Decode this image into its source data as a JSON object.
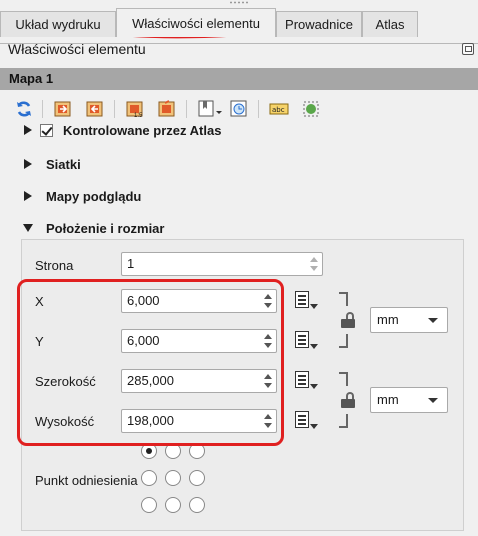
{
  "tabs": [
    {
      "label": "Układ wydruku"
    },
    {
      "label": "Właściwości elementu"
    },
    {
      "label": "Prowadnice"
    },
    {
      "label": "Atlas"
    }
  ],
  "panel_title": "Właściwości elementu",
  "item_header": "Mapa 1",
  "toolbar_icons": [
    "refresh-icon",
    "set-extent-from-canvas-icon",
    "view-extent-in-canvas-icon",
    "set-scale-icon",
    "set-scale-out-icon",
    "bookmarks-icon",
    "temporal-icon",
    "label-settings-icon",
    "clipping-icon"
  ],
  "sections": {
    "atlas_controlled": "Kontrolowane przez Atlas",
    "grids": "Siatki",
    "overviews": "Mapy podglądu",
    "position_size": "Położenie i rozmiar"
  },
  "fields": {
    "page": {
      "label": "Strona",
      "value": "1"
    },
    "x": {
      "label": "X",
      "value": "6,000"
    },
    "y": {
      "label": "Y",
      "value": "6,000"
    },
    "width": {
      "label": "Szerokość",
      "value": "285,000"
    },
    "height": {
      "label": "Wysokość",
      "value": "198,000"
    }
  },
  "units": {
    "position": "mm",
    "size": "mm"
  },
  "reference_point": {
    "label": "Punkt odniesienia",
    "selected_index": 0
  },
  "colors": {
    "annotation": "#e02020",
    "header_bg": "#a6a6a6"
  }
}
